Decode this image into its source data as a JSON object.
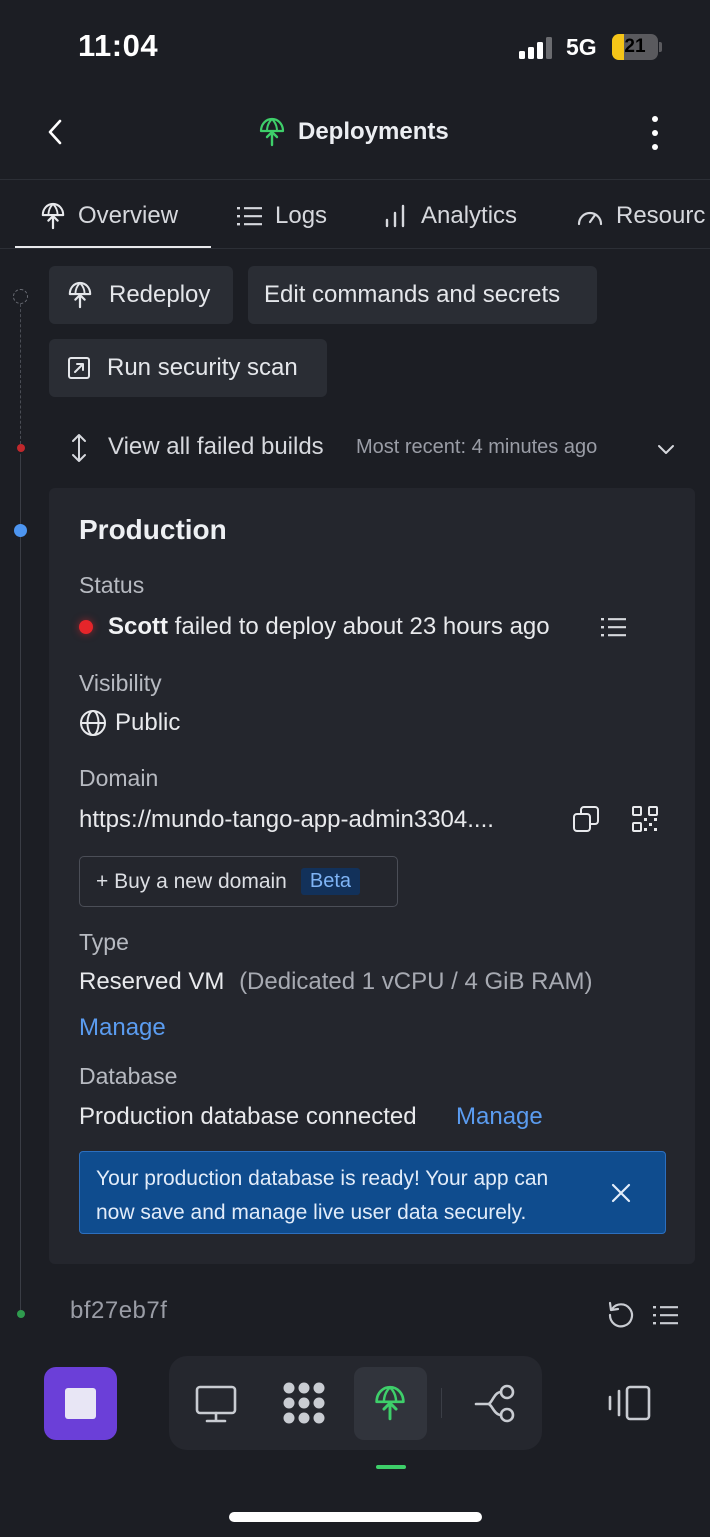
{
  "status_bar": {
    "time": "11:04",
    "network": "5G",
    "battery": "21"
  },
  "header": {
    "title": "Deployments"
  },
  "tabs": [
    {
      "label": "Overview"
    },
    {
      "label": "Logs"
    },
    {
      "label": "Analytics"
    },
    {
      "label": "Resources",
      "visible_text": "Resourc"
    }
  ],
  "actions": {
    "redeploy": "Redeploy",
    "edit": "Edit commands and secrets",
    "scan": "Run security scan"
  },
  "failed_builds": {
    "label": "View all failed builds",
    "recent": "Most recent: 4 minutes ago"
  },
  "production": {
    "title": "Production",
    "status_label": "Status",
    "status_user": "Scott",
    "status_text": "failed to deploy about 23 hours ago",
    "visibility_label": "Visibility",
    "visibility_value": "Public",
    "domain_label": "Domain",
    "domain_value": "https://mundo-tango-app-admin3304....",
    "buy_domain": "+ Buy a new domain",
    "beta": "Beta",
    "type_label": "Type",
    "type_value": "Reserved VM",
    "type_detail": "(Dedicated 1 vCPU / 4 GiB RAM)",
    "type_manage": "Manage",
    "database_label": "Database",
    "database_value": "Production database connected",
    "database_manage": "Manage",
    "banner": "Your production database is ready! Your app can now save and manage live user data securely."
  },
  "commit": {
    "hash": "bf27eb7f"
  },
  "colors": {
    "background": "#1c1e24",
    "card": "#24262d",
    "link": "#5b9cf0",
    "error": "#e5252a",
    "brand_green": "#3ecf6a",
    "stop_button": "#6b3fd8",
    "banner": "#0f4c8e"
  },
  "icons": {
    "header": "deploy-icon",
    "tab_overview": "deploy-icon",
    "tab_logs": "list-icon",
    "tab_analytics": "bar-chart-icon",
    "tab_resources": "gauge-icon",
    "dock": [
      "monitor-icon",
      "grid-icon",
      "deploy-icon",
      "git-branch-icon",
      "panel-icon"
    ]
  }
}
